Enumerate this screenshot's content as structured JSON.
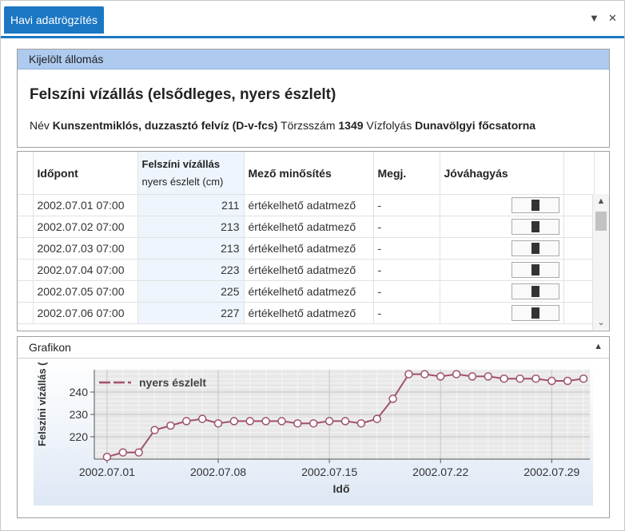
{
  "window": {
    "tab_title": "Havi adatrögzítés",
    "dropdown_glyph": "▼",
    "close_glyph": "✕"
  },
  "station": {
    "header": "Kijelölt állomás",
    "title": "Felszíni vízállás (elsődleges, nyers észlelt)",
    "name_label": "Név",
    "name_value": "Kunszentmiklós,  duzzasztó  felvíz  (D-v-fcs)",
    "id_label": "Törzsszám",
    "id_value": "1349",
    "river_label": "Vízfolyás",
    "river_value": "Dunavölgyi főcsatorna"
  },
  "table": {
    "columns": [
      "Időpont",
      "Felszíni vízállás",
      "nyers észlelt (cm)",
      "Mező minősítés",
      "Megj.",
      "Jóváhagyás"
    ],
    "rows": [
      {
        "time": "2002.07.01 07:00",
        "value": "211",
        "quality": "értékelhető adatmező",
        "note": "-"
      },
      {
        "time": "2002.07.02 07:00",
        "value": "213",
        "quality": "értékelhető adatmező",
        "note": "-"
      },
      {
        "time": "2002.07.03 07:00",
        "value": "213",
        "quality": "értékelhető adatmező",
        "note": "-"
      },
      {
        "time": "2002.07.04 07:00",
        "value": "223",
        "quality": "értékelhető adatmező",
        "note": "-"
      },
      {
        "time": "2002.07.05 07:00",
        "value": "225",
        "quality": "értékelhető adatmező",
        "note": "-"
      },
      {
        "time": "2002.07.06 07:00",
        "value": "227",
        "quality": "értékelhető adatmező",
        "note": "-"
      }
    ],
    "scroll_up": "▲",
    "scroll_down": "⌄"
  },
  "chart_panel": {
    "header": "Grafikon",
    "collapse_glyph": "▲"
  },
  "chart_data": {
    "type": "line",
    "xlabel": "Idő",
    "ylabel": "Felszíni vízállás (",
    "x_tick_labels": [
      "2002.07.01",
      "2002.07.08",
      "2002.07.15",
      "2002.07.22",
      "2002.07.29"
    ],
    "x_tick_days": [
      1,
      8,
      15,
      22,
      29
    ],
    "y_ticks": [
      220,
      230,
      240
    ],
    "ylim": [
      210,
      250
    ],
    "xlim": [
      0.2,
      31.4
    ],
    "legend_position": "top-left",
    "grid": true,
    "series": [
      {
        "name": "nyers észlelt",
        "color": "#a0526b",
        "x": [
          1,
          2,
          3,
          4,
          5,
          6,
          7,
          8,
          9,
          10,
          11,
          12,
          13,
          14,
          15,
          16,
          17,
          18,
          19,
          20,
          21,
          22,
          23,
          24,
          25,
          26,
          27,
          28,
          29,
          30,
          31
        ],
        "y": [
          211,
          213,
          213,
          223,
          225,
          227,
          228,
          226,
          227,
          227,
          227,
          227,
          226,
          226,
          227,
          227,
          226,
          228,
          237,
          248,
          248,
          247,
          248,
          247,
          247,
          246,
          246,
          246,
          245,
          245,
          246
        ]
      }
    ]
  }
}
